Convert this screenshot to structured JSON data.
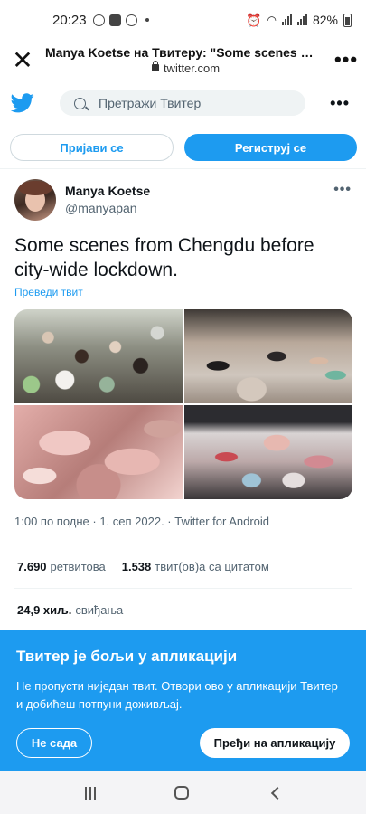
{
  "status_bar": {
    "time": "20:23",
    "battery": "82%"
  },
  "browser": {
    "title": "Manya Koetse на Твитеру: \"Some scenes from Chengdu before city-wide lockdown.\"",
    "url": "twitter.com"
  },
  "twitter_bar": {
    "search_placeholder": "Претражи Твитер"
  },
  "auth": {
    "login_label": "Пријави се",
    "signup_label": "Региструј се"
  },
  "tweet": {
    "author_name": "Manya Koetse",
    "author_handle": "@manyapan",
    "text": "Some scenes from Chengdu before city-wide lockdown.",
    "translate_label": "Преведи твит",
    "timestamp": "1:00 по подне · 1. сеп 2022. · Twitter for Android",
    "retweets_count": "7.690",
    "retweets_label": "ретвитова",
    "quotes_count": "1.538",
    "quotes_label": "твит(ов)а са цитатом",
    "likes_count": "24,9 хиљ.",
    "likes_label": "свиђања"
  },
  "app_promo": {
    "title": "Твитер је бољи у апликацији",
    "body": "Не пропусти ниједан твит. Отвори ово у апликацији Твитер и добићеш потпуни доживљај.",
    "not_now_label": "Не сада",
    "open_app_label": "Пређи на апликацију"
  },
  "colors": {
    "twitter_blue": "#1d9bf0",
    "text_primary": "#0f1419",
    "text_secondary": "#536471"
  }
}
